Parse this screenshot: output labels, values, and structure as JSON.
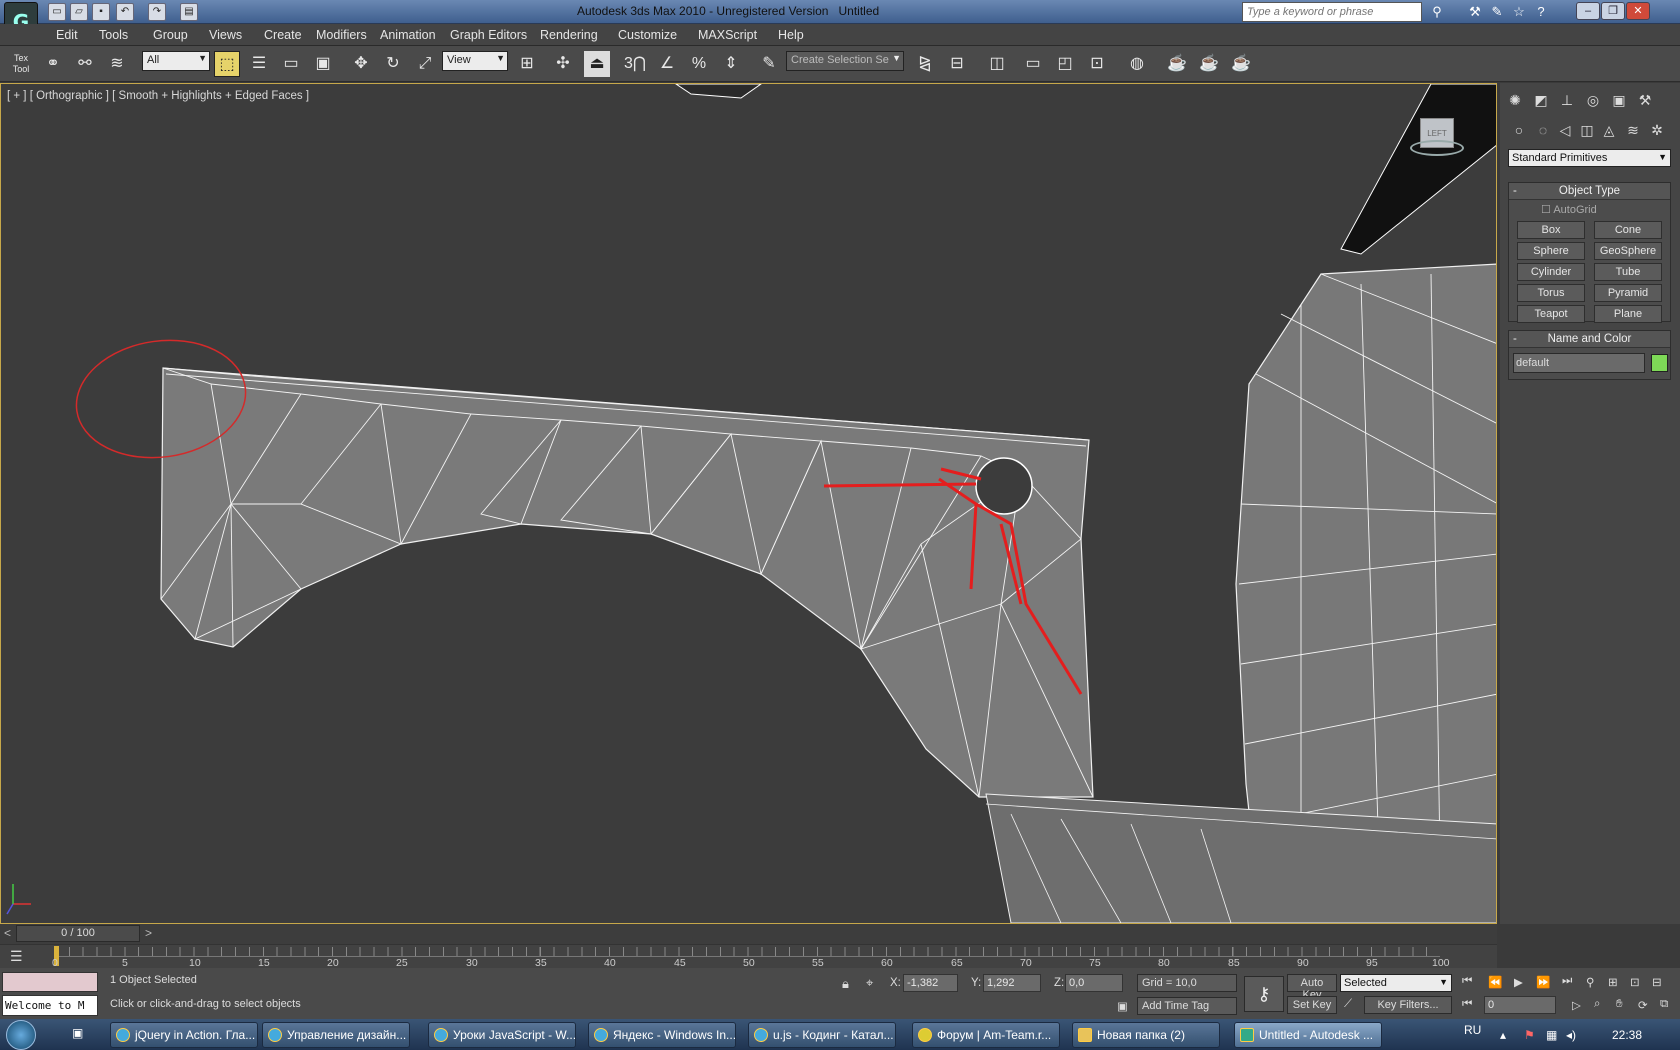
{
  "title": {
    "app": "Autodesk 3ds Max  2010",
    "version": "Unregistered Version",
    "doc": "Untitled",
    "search_placeholder": "Type a keyword or phrase"
  },
  "menu": [
    "Edit",
    "Tools",
    "Group",
    "Views",
    "Create",
    "Modifiers",
    "Animation",
    "Graph Editors",
    "Rendering",
    "Customize",
    "MAXScript",
    "Help"
  ],
  "toolbar": {
    "filter": "All",
    "refcoord": "View",
    "selset": "Create Selection Se"
  },
  "viewport": {
    "label": "[ + ] [ Orthographic ] [ Smooth + Highlights + Edged Faces ]",
    "viewcube": "LEFT"
  },
  "command_panel": {
    "category": "Standard Primitives",
    "object_type_title": "Object Type",
    "autogrid": "AutoGrid",
    "primitives": [
      "Box",
      "Cone",
      "Sphere",
      "GeoSphere",
      "Cylinder",
      "Tube",
      "Torus",
      "Pyramid",
      "Teapot",
      "Plane"
    ],
    "name_color_title": "Name and Color",
    "name_value": "default",
    "color": "#7ed957"
  },
  "timeline": {
    "slider": "0 / 100",
    "ticks": [
      "0",
      "5",
      "10",
      "15",
      "20",
      "25",
      "30",
      "35",
      "40",
      "45",
      "50",
      "55",
      "60",
      "65",
      "70",
      "75",
      "80",
      "85",
      "90",
      "95",
      "100"
    ]
  },
  "status": {
    "selected": "1 Object Selected",
    "prompt": "Click or click-and-drag to select objects",
    "welcome": "Welcome to M",
    "x_label": "X:",
    "x": "-1,382",
    "y_label": "Y:",
    "y": "1,292",
    "z_label": "Z:",
    "z": "0,0",
    "grid": "Grid = 10,0",
    "add_time_tag": "Add Time Tag",
    "auto_key": "Auto Key",
    "set_key": "Set Key",
    "key_mode": "Selected",
    "key_filters": "Key Filters...",
    "frame": "0"
  },
  "taskbar": {
    "items": [
      "jQuery in Action. Гла...",
      "Управление дизайн...",
      "Уроки JavaScript - W...",
      "Яндекс - Windows In...",
      "u.js - Кодинг - Катал...",
      "Форум | Am-Team.r...",
      "Новая папка (2)",
      "Untitled - Autodesk ..."
    ],
    "lang": "RU",
    "time": "22:38"
  }
}
